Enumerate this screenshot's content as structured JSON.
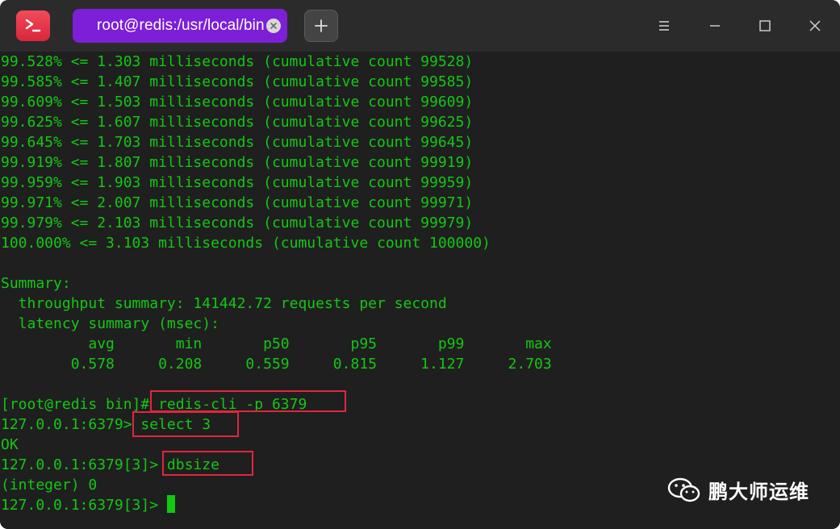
{
  "window": {
    "tab_title": "root@redis:/usr/local/bin"
  },
  "terminal": {
    "lines": [
      "99.528% <= 1.303 milliseconds (cumulative count 99528)",
      "99.585% <= 1.407 milliseconds (cumulative count 99585)",
      "99.609% <= 1.503 milliseconds (cumulative count 99609)",
      "99.625% <= 1.607 milliseconds (cumulative count 99625)",
      "99.645% <= 1.703 milliseconds (cumulative count 99645)",
      "99.919% <= 1.807 milliseconds (cumulative count 99919)",
      "99.959% <= 1.903 milliseconds (cumulative count 99959)",
      "99.971% <= 2.007 milliseconds (cumulative count 99971)",
      "99.979% <= 2.103 milliseconds (cumulative count 99979)",
      "100.000% <= 3.103 milliseconds (cumulative count 100000)",
      "",
      "Summary:",
      "  throughput summary: 141442.72 requests per second",
      "  latency summary (msec):",
      "          avg       min       p50       p95       p99       max",
      "        0.578     0.208     0.559     0.815     1.127     2.703",
      "",
      "[root@redis bin]# redis-cli -p 6379",
      "127.0.0.1:6379> select 3",
      "OK",
      "127.0.0.1:6379[3]> dbsize",
      "(integer) 0",
      "127.0.0.1:6379[3]> "
    ]
  },
  "watermark": {
    "text": "鹏大师运维"
  },
  "colors": {
    "terminal_bg": "#1f1f1f",
    "terminal_fg": "#12c812",
    "tab_accent": "#7c1fd7",
    "highlight_box": "#e0263f"
  }
}
